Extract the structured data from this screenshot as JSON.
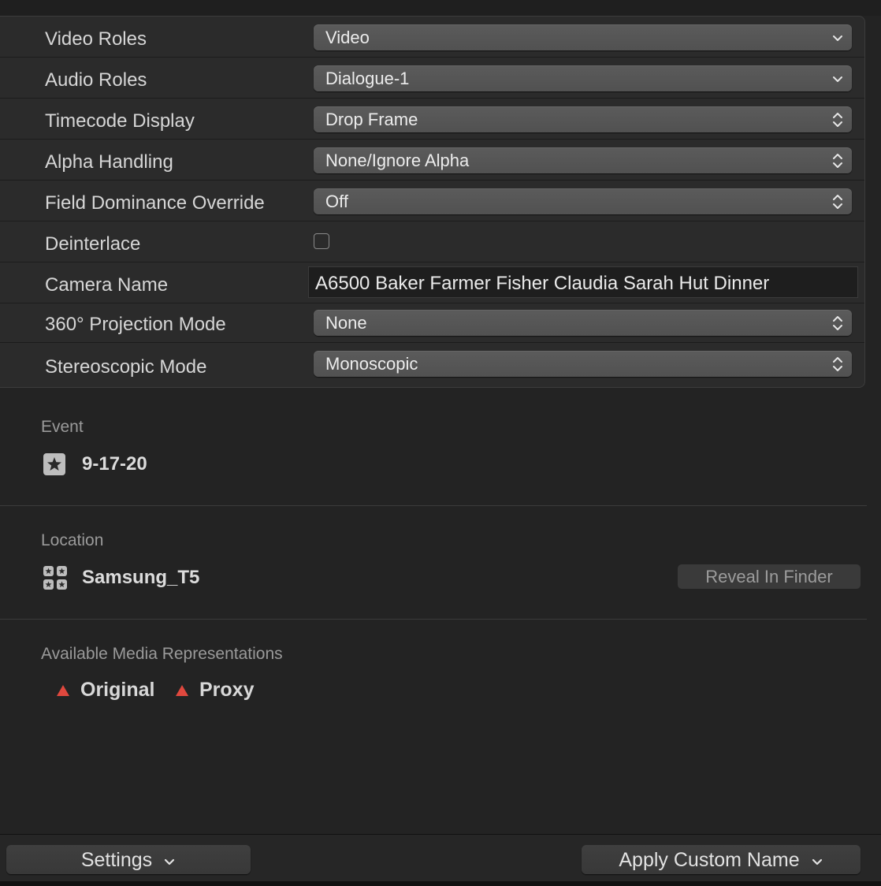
{
  "properties": [
    {
      "label": "Video Roles",
      "type": "popup",
      "value": "Video",
      "arrow": "chevron-down-icon"
    },
    {
      "label": "Audio Roles",
      "type": "popup",
      "value": "Dialogue-1",
      "arrow": "chevron-down-icon"
    },
    {
      "label": "Timecode Display",
      "type": "popup",
      "value": "Drop Frame",
      "arrow": "up-down-arrows-icon"
    },
    {
      "label": "Alpha Handling",
      "type": "popup",
      "value": "None/Ignore Alpha",
      "arrow": "up-down-arrows-icon"
    },
    {
      "label": "Field Dominance Override",
      "type": "popup",
      "value": "Off",
      "arrow": "up-down-arrows-icon"
    },
    {
      "label": "Deinterlace",
      "type": "checkbox",
      "checked": false
    },
    {
      "label": "Camera Name",
      "type": "text",
      "value": "A6500 Baker Farmer Fisher Claudia Sarah Hut Dinner"
    },
    {
      "label": "360° Projection Mode",
      "type": "popup",
      "value": "None",
      "arrow": "up-down-arrows-icon"
    },
    {
      "label": "Stereoscopic Mode",
      "type": "popup",
      "value": "Monoscopic",
      "arrow": "up-down-arrows-icon"
    }
  ],
  "event": {
    "title": "Event",
    "value": "9-17-20",
    "icon": "star-event-icon"
  },
  "location": {
    "title": "Location",
    "value": "Samsung_T5",
    "icon": "library-drive-icon",
    "reveal_label": "Reveal In Finder"
  },
  "media": {
    "title": "Available Media Representations",
    "items": [
      {
        "label": "Original",
        "icon": "warning-triangle-icon"
      },
      {
        "label": "Proxy",
        "icon": "warning-triangle-icon"
      }
    ]
  },
  "bottom": {
    "settings_label": "Settings",
    "apply_label": "Apply Custom Name"
  },
  "colors": {
    "background": "#232323",
    "popup": "#555555",
    "warning": "#e0483e"
  }
}
